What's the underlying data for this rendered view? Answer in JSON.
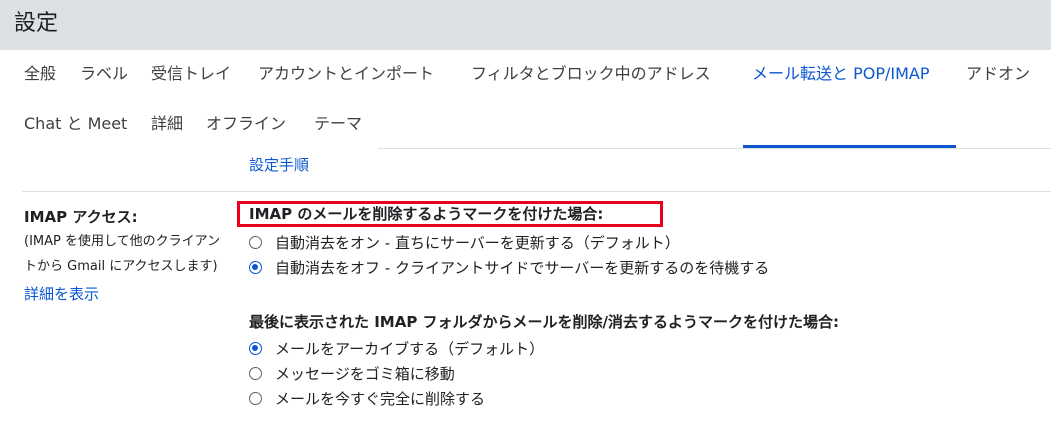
{
  "header": {
    "title": "設定"
  },
  "tabs": [
    {
      "label": "全般"
    },
    {
      "label": "ラベル"
    },
    {
      "label": "受信トレイ"
    },
    {
      "label": "アカウントとインポート"
    },
    {
      "label": "フィルタとブロック中のアドレス"
    },
    {
      "label": "メール転送と POP/IMAP",
      "active": true
    },
    {
      "label": "アドオン"
    },
    {
      "label": "Chat と Meet"
    },
    {
      "label": "詳細"
    },
    {
      "label": "オフライン"
    },
    {
      "label": "テーマ"
    }
  ],
  "setup_link": "設定手順",
  "imap": {
    "section_title": "IMAP アクセス:",
    "description_line1": "(IMAP を使用して他のクライアン",
    "description_line2": "トから Gmail にアクセスします)",
    "details_link": "詳細を表示",
    "delete_group": {
      "heading": "IMAP のメールを削除するようマークを付けた場合:",
      "options": [
        {
          "label": "自動消去をオン - 直ちにサーバーを更新する（デフォルト）",
          "checked": false
        },
        {
          "label": "自動消去をオフ - クライアントサイドでサーバーを更新するのを待機する",
          "checked": true
        }
      ]
    },
    "expunge_group": {
      "heading": "最後に表示された IMAP フォルダからメールを削除/消去するようマークを付けた場合:",
      "options": [
        {
          "label": "メールをアーカイブする（デフォルト）",
          "checked": true
        },
        {
          "label": "メッセージをゴミ箱に移動",
          "checked": false
        },
        {
          "label": "メールを今すぐ完全に削除する",
          "checked": false
        }
      ]
    }
  },
  "colors": {
    "accent": "#0b57d0",
    "highlight": "#e8001c",
    "header_bg": "#dde1e6"
  }
}
